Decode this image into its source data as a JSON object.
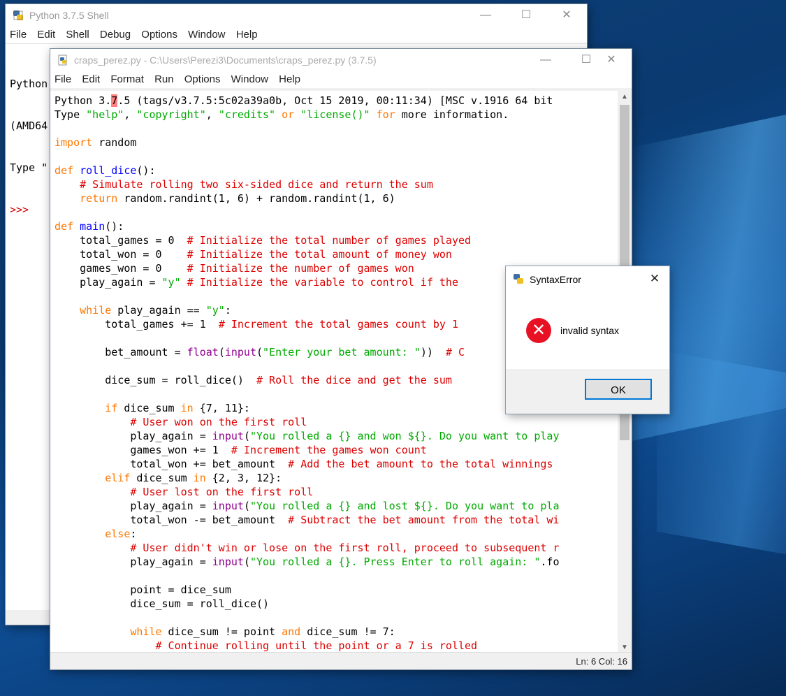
{
  "shell_window": {
    "title": "Python 3.7.5 Shell",
    "menu": [
      "File",
      "Edit",
      "Shell",
      "Debug",
      "Options",
      "Window",
      "Help"
    ],
    "lines": [
      "Python",
      "(AMD64",
      "Type \"",
      ">>>"
    ],
    "controls": {
      "minimize": "—",
      "maximize": "☐",
      "close": "✕"
    }
  },
  "editor_window": {
    "title": "craps_perez.py - C:\\Users\\Perezi3\\Documents\\craps_perez.py (3.7.5)",
    "menu": [
      "File",
      "Edit",
      "Format",
      "Run",
      "Options",
      "Window",
      "Help"
    ],
    "controls": {
      "minimize": "—",
      "maximize": "☐",
      "close": "✕"
    },
    "status": "Ln: 6  Col: 16",
    "code_lines": [
      [
        {
          "t": "Python 3."
        },
        {
          "t": "7",
          "c": "err"
        },
        {
          "t": ".5 (tags/v3.7.5:5c02a39a0b, Oct 15 2019, 00:11:34) [MSC v.1916 64 bit"
        }
      ],
      [
        {
          "t": "Type "
        },
        {
          "t": "\"help\"",
          "c": "st"
        },
        {
          "t": ", "
        },
        {
          "t": "\"copyright\"",
          "c": "st"
        },
        {
          "t": ", "
        },
        {
          "t": "\"credits\"",
          "c": "st"
        },
        {
          "t": " or ",
          "c": "kw"
        },
        {
          "t": "\"license()\"",
          "c": "st"
        },
        {
          "t": " for ",
          "c": "kw"
        },
        {
          "t": "more information."
        }
      ],
      [],
      [
        {
          "t": "import",
          "c": "kw"
        },
        {
          "t": " random"
        }
      ],
      [],
      [
        {
          "t": "def",
          "c": "kw"
        },
        {
          "t": " "
        },
        {
          "t": "roll_dice",
          "c": "fn"
        },
        {
          "t": "():"
        }
      ],
      [
        {
          "t": "    "
        },
        {
          "t": "# Simulate rolling two six-sided dice and return the sum",
          "c": "cm"
        }
      ],
      [
        {
          "t": "    "
        },
        {
          "t": "return",
          "c": "kw"
        },
        {
          "t": " random.randint(1, 6) + random.randint(1, 6)"
        }
      ],
      [],
      [
        {
          "t": "def",
          "c": "kw"
        },
        {
          "t": " "
        },
        {
          "t": "main",
          "c": "fn"
        },
        {
          "t": "():"
        }
      ],
      [
        {
          "t": "    total_games = 0  "
        },
        {
          "t": "# Initialize the total number of games played",
          "c": "cm"
        }
      ],
      [
        {
          "t": "    total_won = 0    "
        },
        {
          "t": "# Initialize the total amount of money won",
          "c": "cm"
        }
      ],
      [
        {
          "t": "    games_won = 0    "
        },
        {
          "t": "# Initialize the number of games won",
          "c": "cm"
        }
      ],
      [
        {
          "t": "    play_again = "
        },
        {
          "t": "\"y\"",
          "c": "st"
        },
        {
          "t": " "
        },
        {
          "t": "# Initialize the variable to control if the",
          "c": "cm"
        }
      ],
      [],
      [
        {
          "t": "    "
        },
        {
          "t": "while",
          "c": "kw"
        },
        {
          "t": " play_again == "
        },
        {
          "t": "\"y\"",
          "c": "st"
        },
        {
          "t": ":"
        }
      ],
      [
        {
          "t": "        total_games += 1  "
        },
        {
          "t": "# Increment the total games count by 1",
          "c": "cm"
        }
      ],
      [],
      [
        {
          "t": "        bet_amount = "
        },
        {
          "t": "float",
          "c": "bi"
        },
        {
          "t": "("
        },
        {
          "t": "input",
          "c": "bi"
        },
        {
          "t": "("
        },
        {
          "t": "\"Enter your bet amount: \"",
          "c": "st"
        },
        {
          "t": "))  "
        },
        {
          "t": "# C",
          "c": "cm"
        }
      ],
      [],
      [
        {
          "t": "        dice_sum = roll_dice()  "
        },
        {
          "t": "# Roll the dice and get the sum",
          "c": "cm"
        }
      ],
      [],
      [
        {
          "t": "        "
        },
        {
          "t": "if",
          "c": "kw"
        },
        {
          "t": " dice_sum "
        },
        {
          "t": "in",
          "c": "kw"
        },
        {
          "t": " {7, 11}:"
        }
      ],
      [
        {
          "t": "            "
        },
        {
          "t": "# User won on the first roll",
          "c": "cm"
        }
      ],
      [
        {
          "t": "            play_again = "
        },
        {
          "t": "input",
          "c": "bi"
        },
        {
          "t": "("
        },
        {
          "t": "\"You rolled a {} and won ${}. Do you want to play",
          "c": "st"
        }
      ],
      [
        {
          "t": "            games_won += 1  "
        },
        {
          "t": "# Increment the games won count",
          "c": "cm"
        }
      ],
      [
        {
          "t": "            total_won += bet_amount  "
        },
        {
          "t": "# Add the bet amount to the total winnings",
          "c": "cm"
        }
      ],
      [
        {
          "t": "        "
        },
        {
          "t": "elif",
          "c": "kw"
        },
        {
          "t": " dice_sum "
        },
        {
          "t": "in",
          "c": "kw"
        },
        {
          "t": " {2, 3, 12}:"
        }
      ],
      [
        {
          "t": "            "
        },
        {
          "t": "# User lost on the first roll",
          "c": "cm"
        }
      ],
      [
        {
          "t": "            play_again = "
        },
        {
          "t": "input",
          "c": "bi"
        },
        {
          "t": "("
        },
        {
          "t": "\"You rolled a {} and lost ${}. Do you want to pla",
          "c": "st"
        }
      ],
      [
        {
          "t": "            total_won -= bet_amount  "
        },
        {
          "t": "# Subtract the bet amount from the total wi",
          "c": "cm"
        }
      ],
      [
        {
          "t": "        "
        },
        {
          "t": "else",
          "c": "kw"
        },
        {
          "t": ":"
        }
      ],
      [
        {
          "t": "            "
        },
        {
          "t": "# User didn't win or lose on the first roll, proceed to subsequent r",
          "c": "cm"
        }
      ],
      [
        {
          "t": "            play_again = "
        },
        {
          "t": "input",
          "c": "bi"
        },
        {
          "t": "("
        },
        {
          "t": "\"You rolled a {}. Press Enter to roll again: \"",
          "c": "st"
        },
        {
          "t": ".fo"
        }
      ],
      [],
      [
        {
          "t": "            point = dice_sum"
        }
      ],
      [
        {
          "t": "            dice_sum = roll_dice()"
        }
      ],
      [],
      [
        {
          "t": "            "
        },
        {
          "t": "while",
          "c": "kw"
        },
        {
          "t": " dice_sum != point "
        },
        {
          "t": "and",
          "c": "kw"
        },
        {
          "t": " dice_sum != 7:"
        }
      ],
      [
        {
          "t": "                "
        },
        {
          "t": "# Continue rolling until the point or a 7 is rolled",
          "c": "cm"
        }
      ]
    ]
  },
  "dialog": {
    "title": "SyntaxError",
    "message": "invalid syntax",
    "ok_label": "OK",
    "close_glyph": "✕",
    "error_glyph": "✕"
  },
  "colors": {
    "keyword": "#ff7700",
    "string": "#00aa00",
    "comment": "#dd0000",
    "builtin": "#900090",
    "definition": "#0000ff",
    "error_highlight": "#ff8080",
    "accent": "#0078d7"
  }
}
